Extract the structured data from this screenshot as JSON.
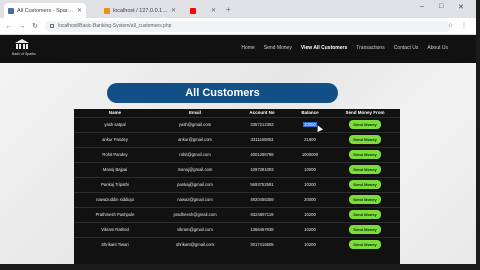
{
  "browser": {
    "tabs": [
      {
        "title": "All Customers - Sparks Bank",
        "active": true,
        "favicon_color": "#4a6fa5"
      },
      {
        "title": "localhost / 127.0.0.1 / sbank / ...",
        "active": false,
        "favicon_color": "#f29111"
      },
      {
        "title": "(1) YouTube",
        "active": false,
        "favicon_color": "#ff0000"
      }
    ],
    "new_tab": "+",
    "window_controls": [
      "–",
      "□",
      "✕"
    ],
    "url": "localhost/Basic-Banking-System/all_customers.php",
    "nav_icons": [
      "back-icon",
      "forward-icon",
      "reload-icon"
    ]
  },
  "site": {
    "logo_text": "Bank of Sparks",
    "nav": [
      {
        "label": "Home",
        "active": false
      },
      {
        "label": "Send Money",
        "active": false
      },
      {
        "label": "View All Customers",
        "active": true
      },
      {
        "label": "Transactions",
        "active": false
      },
      {
        "label": "Contact Us",
        "active": false
      },
      {
        "label": "About Us",
        "active": false
      }
    ]
  },
  "main": {
    "title": "All Customers",
    "table": {
      "headers": [
        "Name",
        "Email",
        "Account No",
        "Balance",
        "Send Money From"
      ],
      "rows": [
        {
          "name": "yash satpal",
          "email": "yash@gmail.com",
          "account": "3357212353",
          "balance": "20000",
          "button": "Send Money"
        },
        {
          "name": "ankur Pandey",
          "email": "ankur@gmail.com",
          "account": "3311160853",
          "balance": "21600",
          "button": "Send Money"
        },
        {
          "name": "Rohit Pandey",
          "email": "rohit@gmail.com",
          "account": "4001286788",
          "balance": "1000000",
          "button": "Send Money"
        },
        {
          "name": "Manoj Bajpai",
          "email": "manoj@gmail.com",
          "account": "1097361093",
          "balance": "10000",
          "button": "Send Money"
        },
        {
          "name": "Pankaj Tripathi",
          "email": "pankaj@gmail.com",
          "account": "5693752581",
          "balance": "10200",
          "button": "Send Money"
        },
        {
          "name": "nawazuddin siddiqui",
          "email": "nawaz@gmail.com",
          "account": "4920455359",
          "balance": "20000",
          "button": "Send Money"
        },
        {
          "name": "Prathmesh Pashpule",
          "email": "pradheesh@gmail.com",
          "account": "8324697119",
          "balance": "10200",
          "button": "Send Money"
        },
        {
          "name": "Vikram Rathod",
          "email": "vikram@gmail.com",
          "account": "1366457638",
          "balance": "10200",
          "button": "Send Money"
        },
        {
          "name": "Shrikant Tiwari",
          "email": "shrikant@gmail.com",
          "account": "3017416605",
          "balance": "10200",
          "button": "Send Money"
        }
      ]
    }
  },
  "colors": {
    "header_bg": "#111111",
    "title_pill": "#124f86",
    "send_button": "#7bdc3c",
    "table_bg": "#111111"
  }
}
